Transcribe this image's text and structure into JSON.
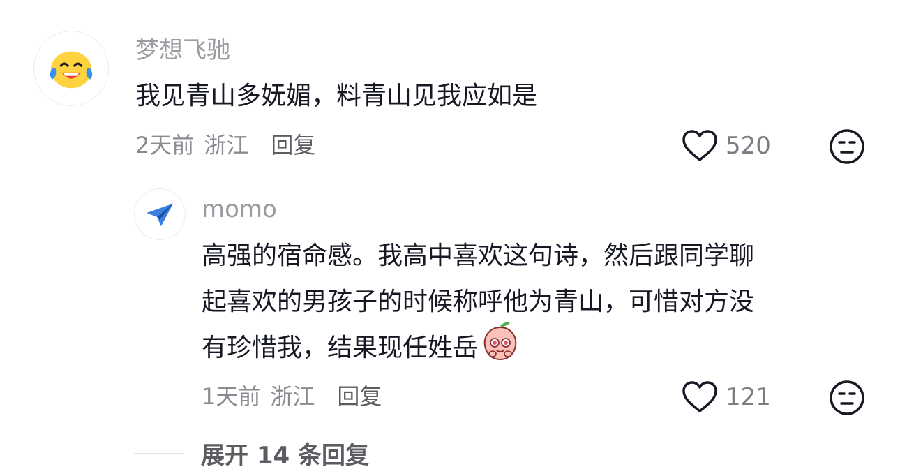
{
  "comment": {
    "avatar_icon": "laughing-tears-emoji",
    "username": "梦想飞驰",
    "text": "我见青山多妩媚，料青山见我应如是",
    "time": "2天前",
    "location": "浙江",
    "reply_label": "回复",
    "like_count": "520",
    "like_icon": "heart-outline-icon",
    "dislike_icon": "neutral-face-icon"
  },
  "reply": {
    "avatar_icon": "paper-plane-icon",
    "username": "momo",
    "text_lines": [
      "高强的宿命感。我高中喜欢这句诗，然后跟同学聊",
      "起喜欢的男孩子的时候称呼他为青山，可惜对方没",
      "有珍惜我，结果现任姓岳"
    ],
    "emoji_icon": "peach-crying-sticker",
    "time": "1天前",
    "location": "浙江",
    "reply_label": "回复",
    "like_count": "121",
    "like_icon": "heart-outline-icon",
    "dislike_icon": "neutral-face-icon"
  },
  "expand_label": "展开 14 条回复",
  "colors": {
    "username": "#9b9ba1",
    "content": "#161823",
    "meta": "#8a8b91",
    "avatar_yellow": "#ffd23f",
    "plane_blue": "#3b82e0"
  }
}
